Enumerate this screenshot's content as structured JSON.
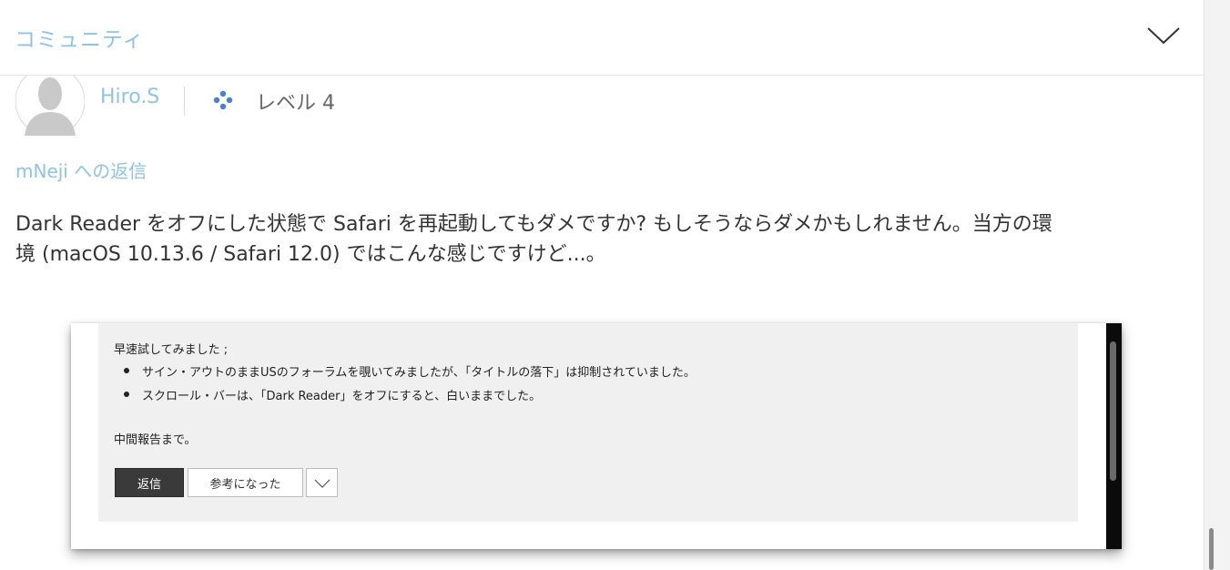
{
  "header": {
    "title": "コミュニティ",
    "chevron_icon": "chevron-down-icon"
  },
  "post": {
    "author": "Hiro.S",
    "level": "レベル 4",
    "reply_to_user": "mNeji",
    "reply_to_suffix": " への返信",
    "line1": "Dark Reader をオフにした状態で Safari を再起動してもダメですか? もしそうならダメかもしれません。当方の環",
    "line2": "境 (macOS 10.13.6 / Safari 12.0) ではこんな感じですけど...。"
  },
  "screenshot": {
    "intro": "早速試してみました ;",
    "bullets": [
      "サイン・アウトのままUSのフォーラムを覗いてみましたが、「タイトルの落下」は抑制されていました。",
      "スクロール・バーは、「Dark Reader」をオフにすると、白いままでした。"
    ],
    "closing": "中間報告まで。",
    "reply_button": "返信",
    "helpful_button": "参考になった"
  },
  "colors": {
    "link": "#8fc3e3",
    "level_icon": "#4a7fd6"
  }
}
